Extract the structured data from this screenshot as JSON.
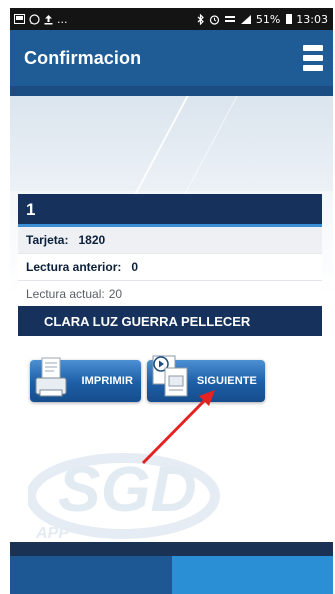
{
  "status_bar": {
    "left_icons": [
      "screenshot-icon",
      "whatsapp-icon",
      "upload-icon"
    ],
    "ellipsis": "...",
    "right_icons": [
      "bluetooth-icon",
      "alarm-icon",
      "lte-icon",
      "signal-icon"
    ],
    "battery": "51%",
    "time": "13:03"
  },
  "app_bar": {
    "title": "Confirmacion",
    "menu_icon": "hamburger-menu-icon"
  },
  "record": {
    "number": "1",
    "tarjeta_label": "Tarjeta:",
    "tarjeta_value": "1820",
    "lectura_anterior_label": "Lectura anterior:",
    "lectura_anterior_value": "0",
    "lectura_actual_label": "Lectura actual:",
    "lectura_actual_value": "20",
    "customer_name": "CLARA LUZ GUERRA PELLECER"
  },
  "actions": {
    "print_label": "IMPRIMIR",
    "next_label": "SIGUIENTE"
  },
  "watermark_logo": "SGD APP",
  "colors": {
    "app_bar": "#1f5b95",
    "header_dark": "#16325c",
    "button": "#1d5ea6",
    "annotation_arrow": "#e52222",
    "footer_tab_right": "#2b8fd6"
  }
}
